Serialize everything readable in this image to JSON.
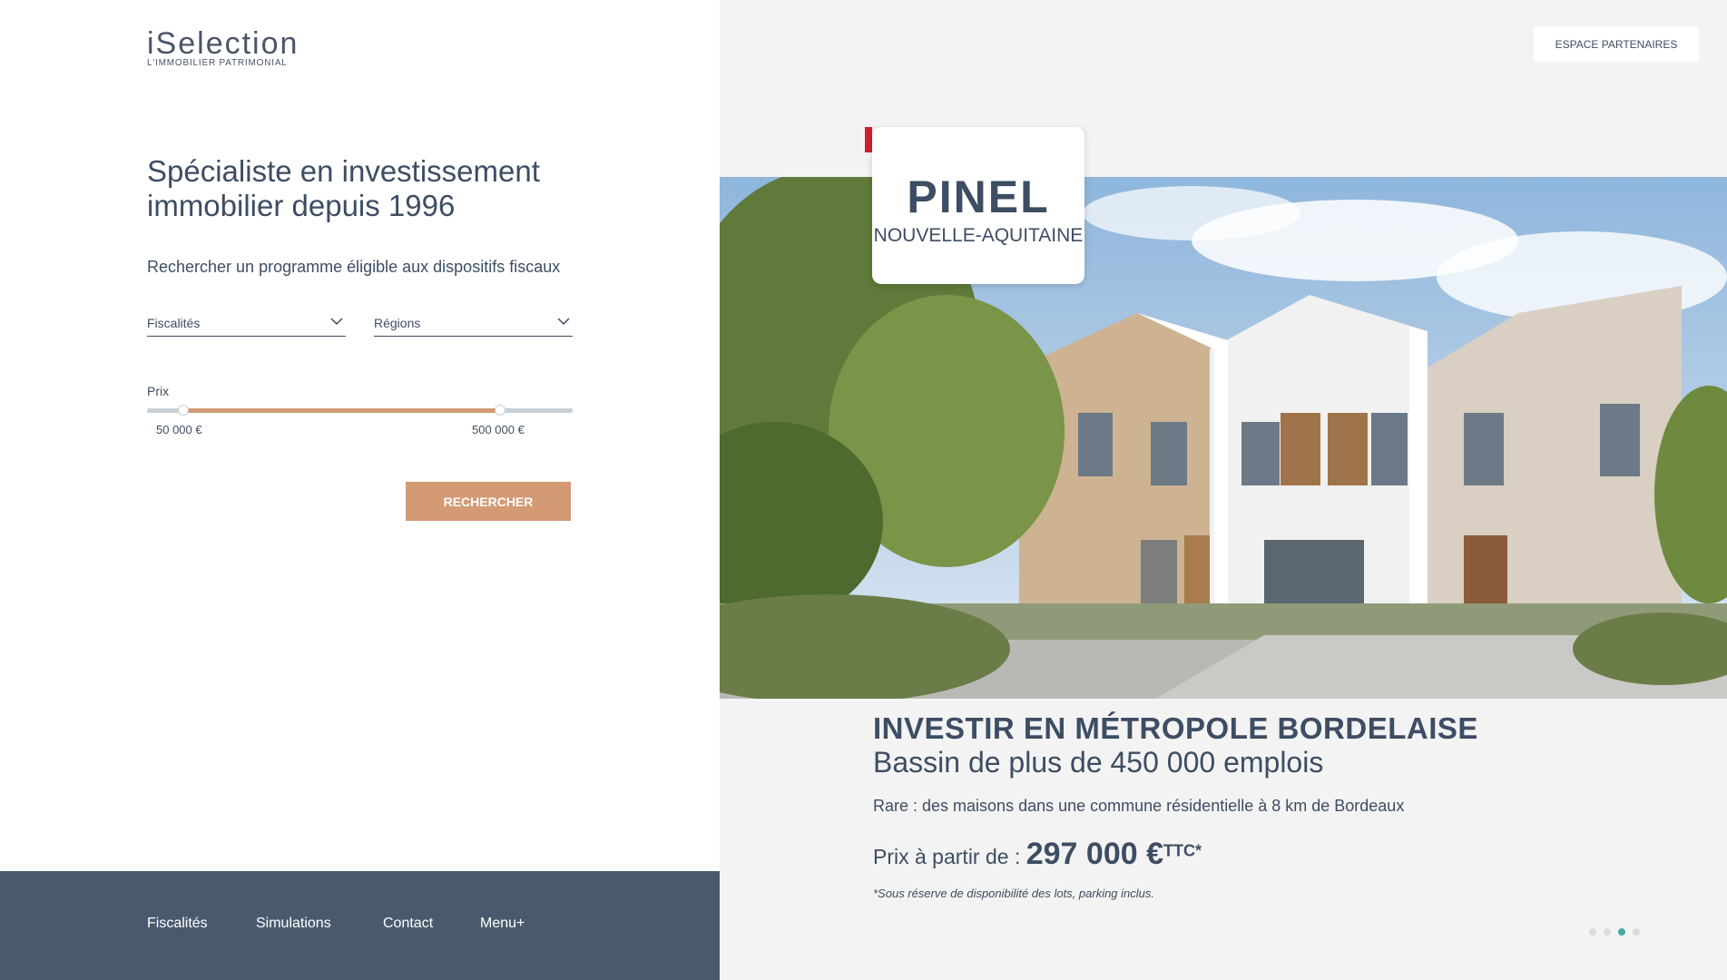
{
  "logo": {
    "name": "iSelection",
    "tagline": "L'IMMOBILIER PATRIMONIAL"
  },
  "hero": {
    "headline": "Spécialiste en investissement immobilier depuis 1996",
    "subtitle": "Rechercher un programme éligible aux dispositifs fiscaux"
  },
  "search": {
    "fiscalites_label": "Fiscalités",
    "regions_label": "Régions",
    "price_label": "Prix",
    "price_min": "50 000 €",
    "price_max": "500 000 €",
    "price_min_fraction": 0.085,
    "price_max_fraction": 0.83,
    "submit_label": "RECHERCHER"
  },
  "footer": {
    "items": [
      "Fiscalités",
      "Simulations",
      "Contact",
      "Menu+"
    ]
  },
  "header": {
    "partners_label": "ESPACE PARTENAIRES"
  },
  "slide": {
    "badge_title": "PINEL",
    "badge_subtitle": "NOUVELLE-AQUITAINE",
    "title": "INVESTIR EN MÉTROPOLE BORDELAISE",
    "subtitle": "Bassin de plus de 450 000 emplois",
    "description": "Rare : des maisons dans une commune résidentielle à 8 km de Bordeaux",
    "price_prefix": "Prix à partir de : ",
    "price_value": "297 000 €",
    "price_suffix": "TTC*",
    "note": "*Sous réserve de disponibilité des lots, parking inclus."
  },
  "carousel": {
    "count": 4,
    "active_index": 2
  },
  "colors": {
    "accent": "#d39a74",
    "footer_bg": "#4a5a6e",
    "text": "#3d4d63",
    "badge_red": "#d0202e",
    "dot_active": "#4aa8a0"
  }
}
